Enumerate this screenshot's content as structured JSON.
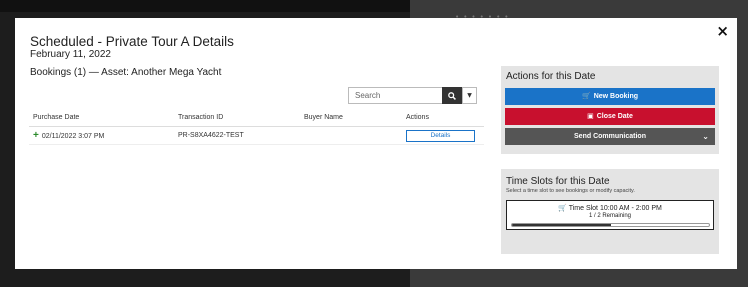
{
  "modal": {
    "title": "Scheduled - Private Tour A Details",
    "date": "February 11, 2022",
    "bookings_heading": "Bookings (1) — Asset: Another Mega Yacht",
    "close_glyph": "×"
  },
  "search": {
    "placeholder": "Search",
    "icon": "search-icon",
    "dropdown_icon": "caret-down-icon"
  },
  "table": {
    "headers": [
      "Purchase Date",
      "Transaction ID",
      "Buyer Name",
      "Actions"
    ],
    "rows": [
      {
        "expand_icon": "+",
        "purchase_date": "02/11/2022 3:07 PM",
        "transaction_id": "PR-S8XA4622-TEST",
        "buyer_name": "",
        "action_label": "Details"
      }
    ]
  },
  "actions": {
    "title": "Actions for this Date",
    "new_booking": {
      "label": "New Booking",
      "icon": "cart-icon",
      "color": "#1a73c8"
    },
    "close_date": {
      "label": "Close Date",
      "icon": "calendar-x-icon",
      "color": "#c8102e"
    },
    "send_communication": {
      "label": "Send Communication",
      "icon": "chevron-down-icon",
      "color": "#555555"
    }
  },
  "time_slots": {
    "title": "Time Slots for this Date",
    "subtitle": "Select a time slot to see bookings or modify capacity.",
    "slots": [
      {
        "label": "Time Slot 10:00 AM - 2:00 PM",
        "icon": "cart-icon",
        "remaining": "1 / 2 Remaining",
        "booked_fraction": 0.5
      }
    ]
  }
}
